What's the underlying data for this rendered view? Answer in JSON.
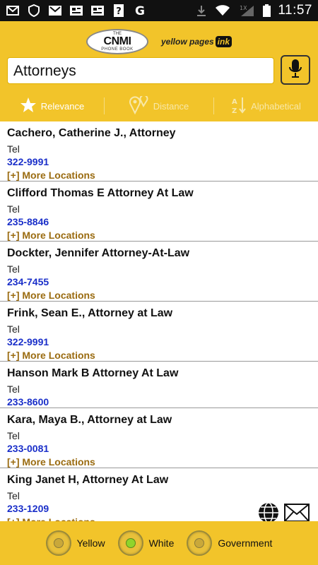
{
  "statusbar": {
    "time": "11:57",
    "signal_label": "1X"
  },
  "search": {
    "query": "Attorneys"
  },
  "logos": {
    "cnmi_top": "THE",
    "cnmi_main": "CNMI",
    "cnmi_bottom": "PHONE BOOK",
    "yp_text": "yellow pages",
    "yp_ink": "ink"
  },
  "sort": [
    {
      "label": "Relevance",
      "icon": "star-icon",
      "active": true
    },
    {
      "label": "Distance",
      "icon": "map-pin-icon",
      "active": false
    },
    {
      "label": "Alphabetical",
      "icon": "sort-az-icon",
      "active": false
    }
  ],
  "listings": [
    {
      "name": "Cachero, Catherine J., Attorney",
      "tel_label": "Tel",
      "phone": "322-9991",
      "more": "[+] More Locations"
    },
    {
      "name": "Clifford Thomas E Attorney At Law",
      "tel_label": "Tel",
      "phone": "235-8846",
      "more": "[+] More Locations"
    },
    {
      "name": "Dockter, Jennifer Attorney-At-Law",
      "tel_label": "Tel",
      "phone": "234-7455",
      "more": "[+] More Locations"
    },
    {
      "name": "Frink, Sean E., Attorney at Law",
      "tel_label": "Tel",
      "phone": "322-9991",
      "more": "[+] More Locations"
    },
    {
      "name": "Hanson Mark B Attorney At Law",
      "tel_label": "Tel",
      "phone": "233-8600",
      "more": ""
    },
    {
      "name": "Kara, Maya B., Attorney at Law",
      "tel_label": "Tel",
      "phone": "233-0081",
      "more": "[+] More Locations"
    },
    {
      "name": "King Janet H, Attorney At Law",
      "tel_label": "Tel",
      "phone": "233-1209",
      "more": "[+] More Locations"
    }
  ],
  "bottom": {
    "options": [
      {
        "label": "Yellow",
        "selected": false
      },
      {
        "label": "White",
        "selected": true
      },
      {
        "label": "Government",
        "selected": false
      }
    ]
  },
  "colors": {
    "accent": "#f2c42a",
    "phone": "#1a2fc9",
    "more": "#9a6b10"
  }
}
